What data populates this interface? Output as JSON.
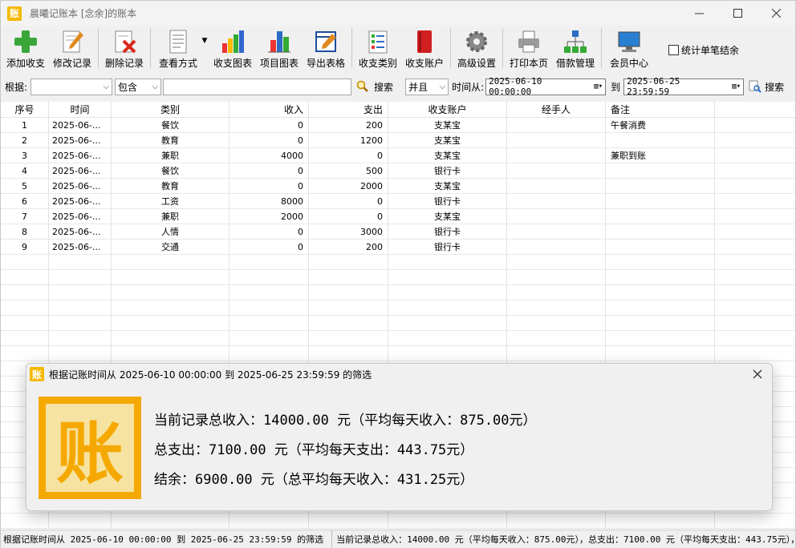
{
  "window": {
    "title": "晨曦记账本  [念余]的账本",
    "app_icon_text": "账"
  },
  "toolbar": {
    "buttons": [
      {
        "label": "添加收支",
        "icon": "add-icon"
      },
      {
        "label": "修改记录",
        "icon": "edit-icon"
      },
      {
        "label": "删除记录",
        "icon": "delete-icon"
      },
      {
        "label": "查看方式",
        "icon": "view-icon"
      },
      {
        "label": "收支图表",
        "icon": "bar-chart-icon"
      },
      {
        "label": "项目图表",
        "icon": "pie-chart-icon"
      },
      {
        "label": "导出表格",
        "icon": "export-icon"
      },
      {
        "label": "收支类别",
        "icon": "category-icon"
      },
      {
        "label": "收支账户",
        "icon": "account-book-icon"
      },
      {
        "label": "高级设置",
        "icon": "gear-icon"
      },
      {
        "label": "打印本页",
        "icon": "printer-icon"
      },
      {
        "label": "借款管理",
        "icon": "network-icon"
      },
      {
        "label": "会员中心",
        "icon": "computer-icon"
      }
    ],
    "single_summary_label": "统计单笔结余"
  },
  "filter": {
    "by_label": "根据:",
    "by_value": "",
    "match_value": "包含",
    "keyword": "",
    "search_label": "搜索",
    "logic_value": "并且",
    "time_from_label": "时间从:",
    "time_from": "2025-06-10 00:00:00",
    "to_label": "到",
    "time_to": "2025-06-25 23:59:59",
    "search2_label": "搜索"
  },
  "table": {
    "columns": [
      "序号",
      "时间",
      "类别",
      "收入",
      "支出",
      "收支账户",
      "经手人",
      "备注"
    ],
    "rows": [
      [
        "1",
        "2025-06-...",
        "餐饮",
        "0",
        "200",
        "支某宝",
        "",
        "午餐消费"
      ],
      [
        "2",
        "2025-06-...",
        "教育",
        "0",
        "1200",
        "支某宝",
        "",
        ""
      ],
      [
        "3",
        "2025-06-...",
        "兼职",
        "4000",
        "0",
        "支某宝",
        "",
        "兼职到账"
      ],
      [
        "4",
        "2025-06-...",
        "餐饮",
        "0",
        "500",
        "银行卡",
        "",
        ""
      ],
      [
        "5",
        "2025-06-...",
        "教育",
        "0",
        "2000",
        "支某宝",
        "",
        ""
      ],
      [
        "6",
        "2025-06-...",
        "工资",
        "8000",
        "0",
        "银行卡",
        "",
        ""
      ],
      [
        "7",
        "2025-06-...",
        "兼职",
        "2000",
        "0",
        "支某宝",
        "",
        ""
      ],
      [
        "8",
        "2025-06-...",
        "人情",
        "0",
        "3000",
        "银行卡",
        "",
        ""
      ],
      [
        "9",
        "2025-06-...",
        "交通",
        "0",
        "200",
        "银行卡",
        "",
        ""
      ]
    ]
  },
  "popup": {
    "title": "根据记账时间从 2025-06-10 00:00:00 到 2025-06-25 23:59:59 的筛选",
    "logo_text": "账",
    "line1": "当前记录总收入：14000.00 元（平均每天收入：875.00元）",
    "line2": "总支出：7100.00 元（平均每天支出：443.75元）",
    "line3": "结余：6900.00 元（总平均每天收入：431.25元）"
  },
  "status": {
    "left": "根据记账时间从 2025-06-10 00:00:00 到 2025-06-25 23:59:59 的筛选",
    "right": "当前记录总收入：14000.00 元（平均每天收入：875.00元），总支出：7100.00 元（平均每天支出：443.75元），"
  }
}
